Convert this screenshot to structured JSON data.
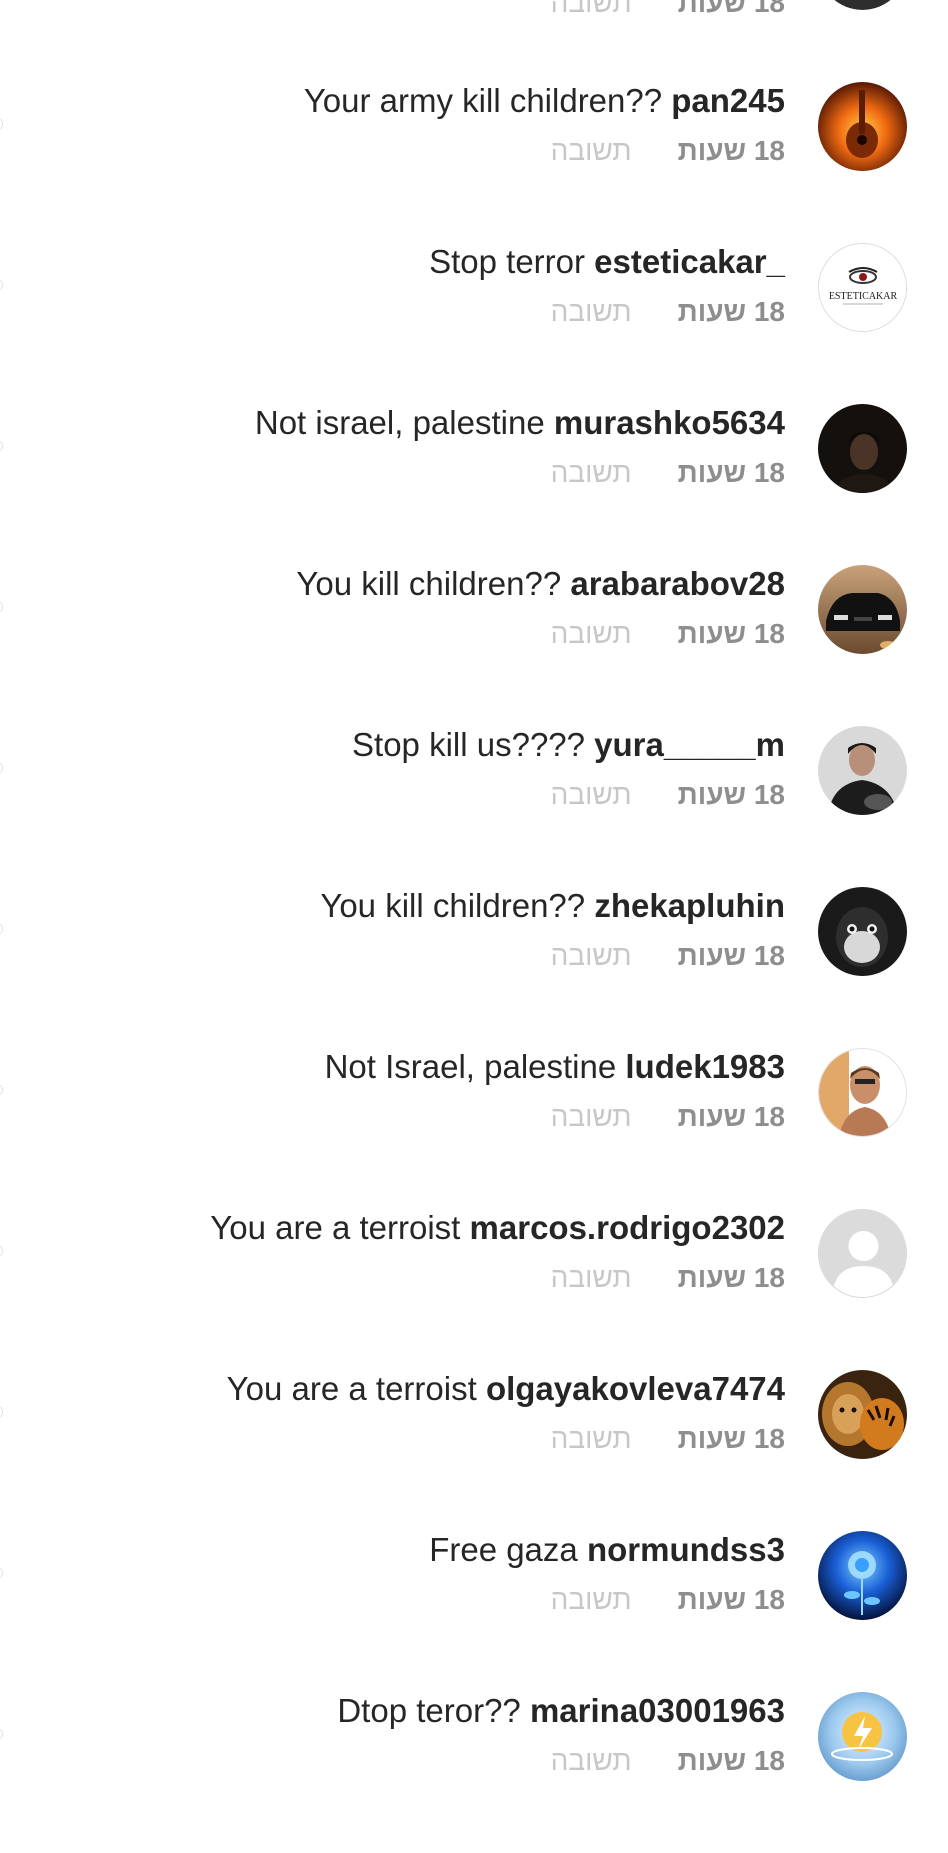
{
  "top_partial": {
    "time": "18 שעות",
    "reply": "תשובה"
  },
  "comments": [
    {
      "username": "pan245",
      "text": "Your army kill children??",
      "time": "18 שעות",
      "reply": "תשובה",
      "avatar": "guitar-fire"
    },
    {
      "username": "esteticakar_",
      "text": "Stop terror",
      "time": "18 שעות",
      "reply": "תשובה",
      "avatar": "esteticakar-logo",
      "avatar_text": "ESTETICAKAR"
    },
    {
      "username": "murashko5634",
      "text": "Not israel, palestine",
      "time": "18 שעות",
      "reply": "תשובה",
      "avatar": "dark-portrait"
    },
    {
      "username": "arabarabov28",
      "text": "You kill children??",
      "time": "18 שעות",
      "reply": "תשובה",
      "avatar": "black-car"
    },
    {
      "username": "yura_____m",
      "text": "Stop kill us????",
      "time": "18 שעות",
      "reply": "תשובה",
      "avatar": "man-portrait"
    },
    {
      "username": "zhekapluhin",
      "text": "You kill children??",
      "time": "18 שעות",
      "reply": "תשובה",
      "avatar": "monkey"
    },
    {
      "username": "ludek1983",
      "text": "Not Israel, palestine",
      "time": "18 שעות",
      "reply": "תשובה",
      "avatar": "selfie"
    },
    {
      "username": "marcos.rodrigo2302",
      "text": "You are a terroist",
      "time": "18 שעות",
      "reply": "תשובה",
      "avatar": "default-user"
    },
    {
      "username": "olgayakovleva7474",
      "text": "You are a terroist",
      "time": "18 שעות",
      "reply": "תשובה",
      "avatar": "lion-tiger"
    },
    {
      "username": "normundss3",
      "text": "Free gaza",
      "time": "18 שעות",
      "reply": "תשובה",
      "avatar": "blue-rose"
    },
    {
      "username": "marina03001963",
      "text": "Dtop teror??",
      "time": "18 שעות",
      "reply": "תשובה",
      "avatar": "lightning-globe"
    }
  ]
}
